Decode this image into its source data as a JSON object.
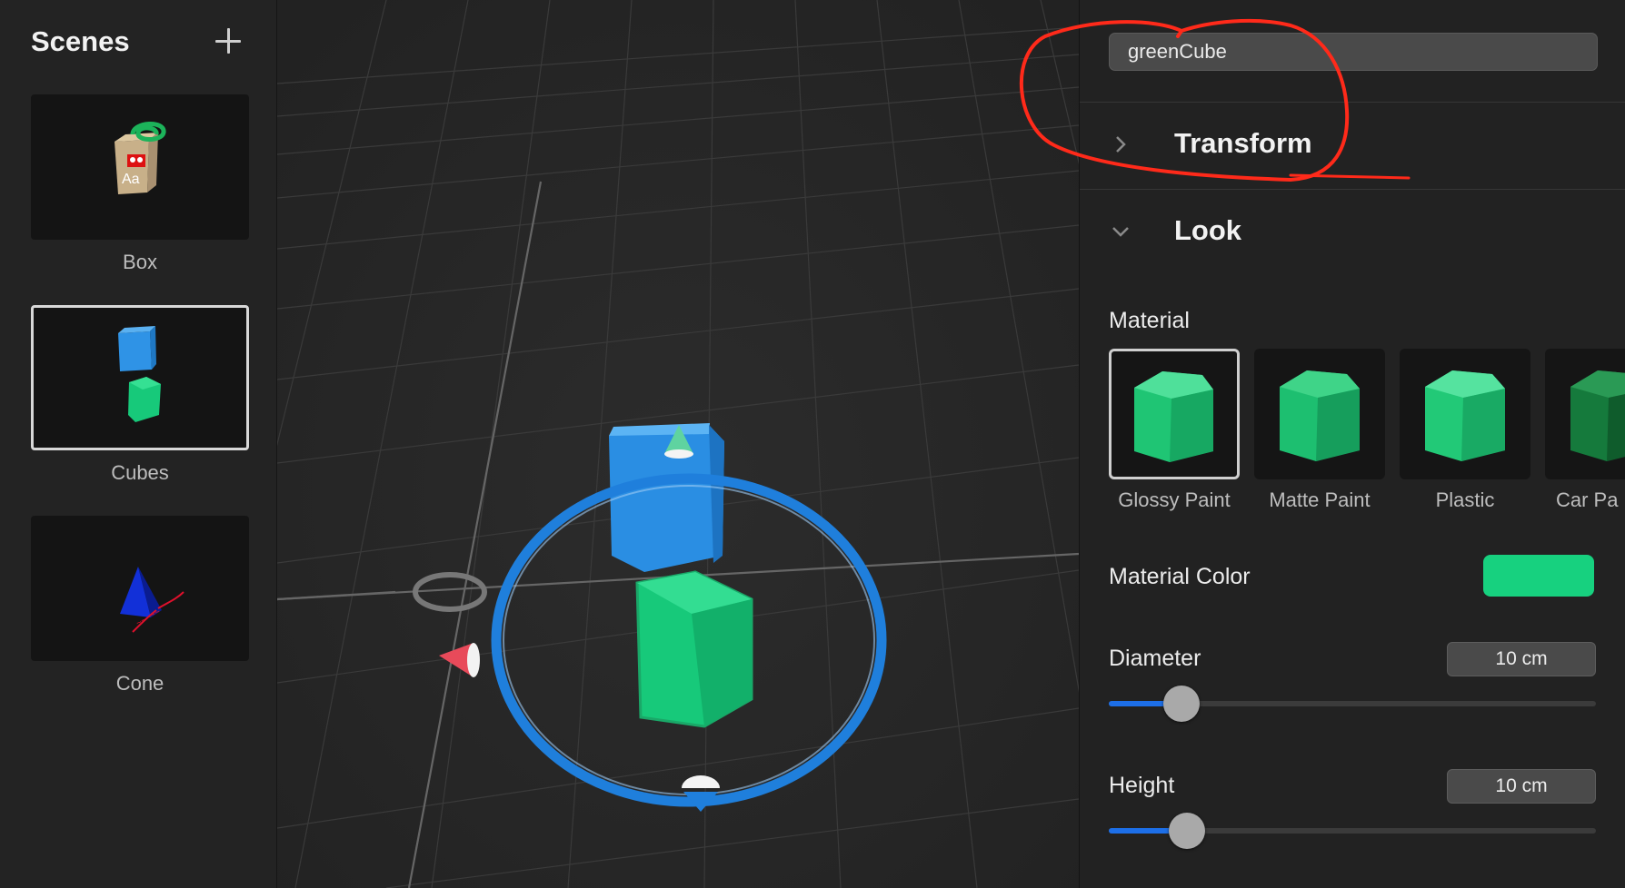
{
  "sidebar": {
    "title": "Scenes",
    "add_icon": "plus-icon",
    "scenes": [
      {
        "label": "Box",
        "selected": false
      },
      {
        "label": "Cubes",
        "selected": true
      },
      {
        "label": "Cone",
        "selected": false
      }
    ]
  },
  "inspector": {
    "name_value": "greenCube",
    "transform": {
      "label": "Transform",
      "expanded": false,
      "icon": "chevron-right-icon"
    },
    "look": {
      "label": "Look",
      "expanded": true,
      "icon": "chevron-down-icon"
    },
    "material": {
      "label": "Material",
      "options": [
        {
          "label": "Glossy Paint",
          "selected": true
        },
        {
          "label": "Matte Paint",
          "selected": false
        },
        {
          "label": "Plastic",
          "selected": false
        },
        {
          "label": "Car Pa",
          "selected": false
        }
      ]
    },
    "material_color": {
      "label": "Material Color",
      "value": "#17d17f"
    },
    "diameter": {
      "label": "Diameter",
      "value": "10 cm",
      "slider_fraction": 0.15
    },
    "height": {
      "label": "Height",
      "value": "10 cm",
      "slider_fraction": 0.16
    }
  },
  "colors": {
    "accent_blue": "#1d6fe8",
    "cube_green": "#17c97a",
    "cube_blue": "#2f93e6",
    "annotation_red": "#ff2a1a"
  }
}
